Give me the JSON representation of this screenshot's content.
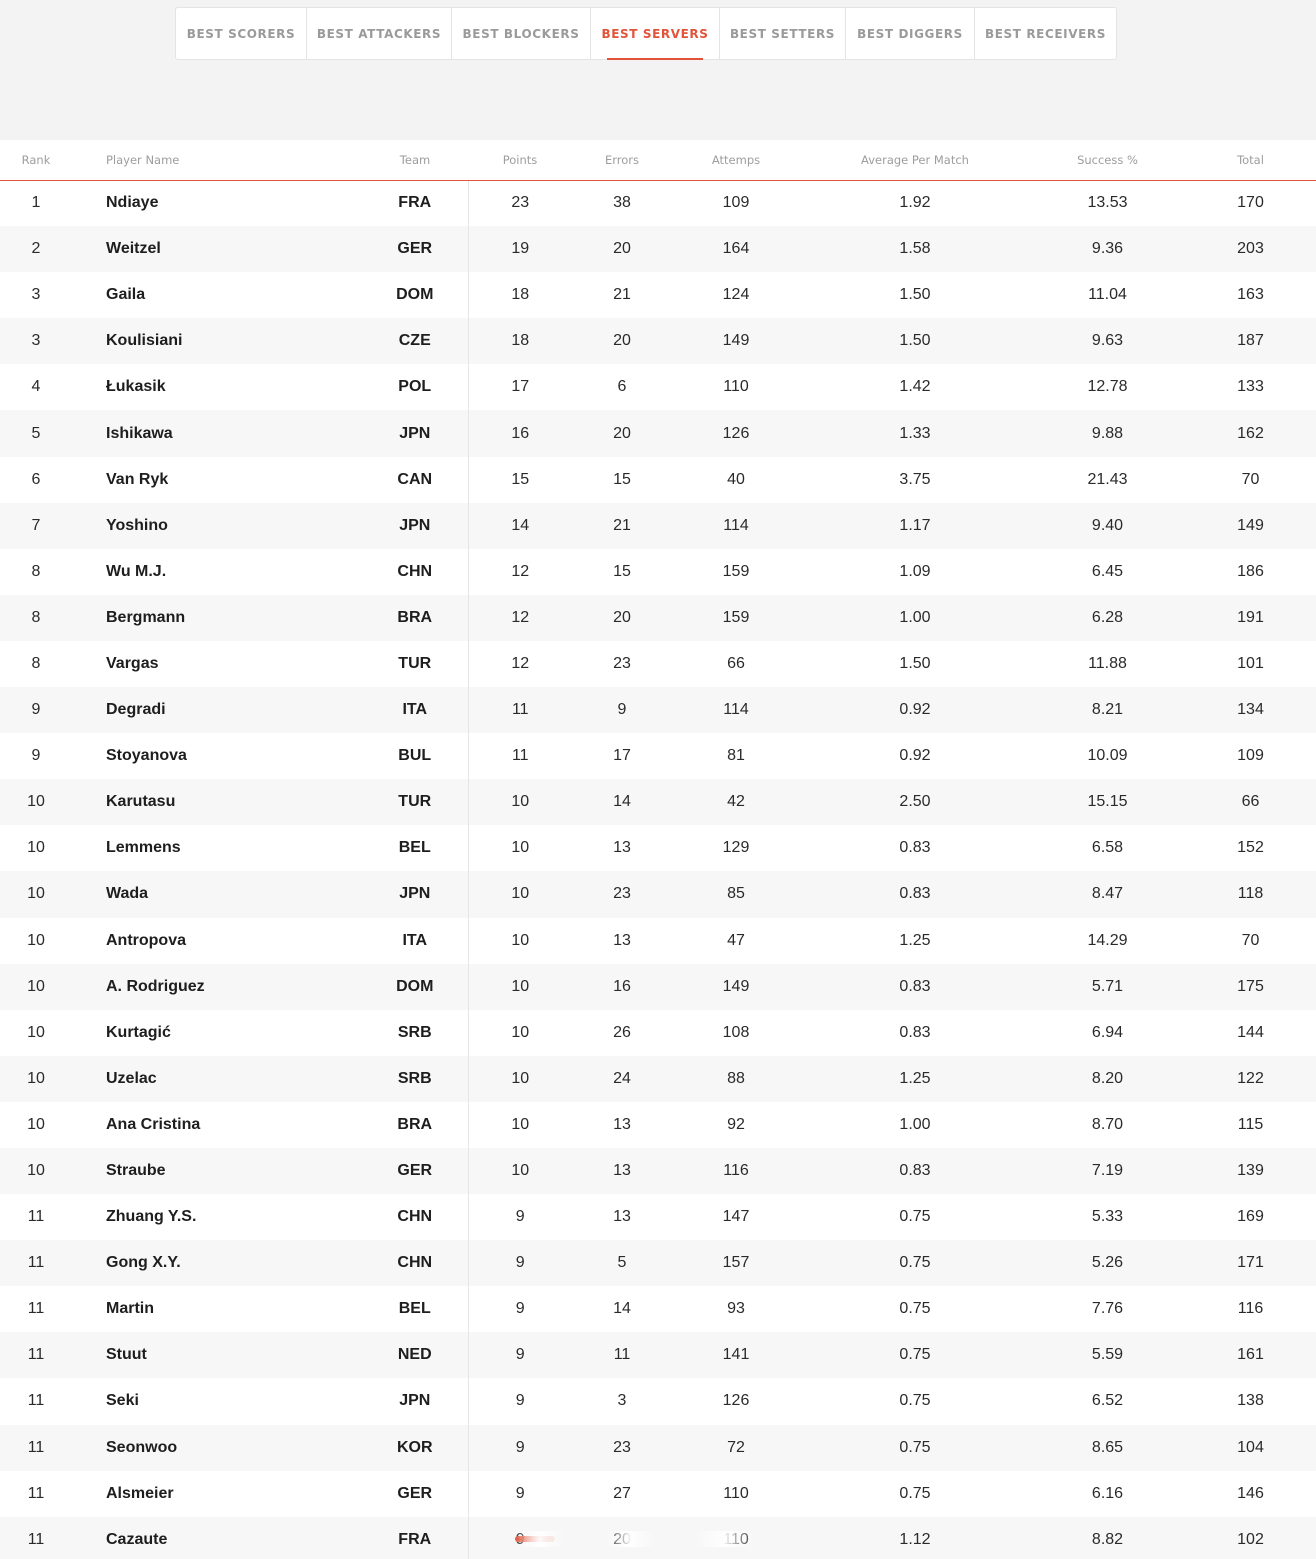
{
  "tabs": [
    {
      "label": "BEST SCORERS",
      "active": false
    },
    {
      "label": "BEST ATTACKERS",
      "active": false
    },
    {
      "label": "BEST BLOCKERS",
      "active": false
    },
    {
      "label": "BEST SERVERS",
      "active": true
    },
    {
      "label": "BEST SETTERS",
      "active": false
    },
    {
      "label": "BEST DIGGERS",
      "active": false
    },
    {
      "label": "BEST RECEIVERS",
      "active": false
    }
  ],
  "table": {
    "headers": {
      "rank": "Rank",
      "player": "Player Name",
      "team": "Team",
      "points": "Points",
      "errors": "Errors",
      "attempts": "Attemps",
      "avg": "Average Per Match",
      "success": "Success %",
      "total": "Total"
    },
    "rows": [
      {
        "rank": "1",
        "player": "Ndiaye",
        "team": "FRA",
        "points": "23",
        "errors": "38",
        "attempts": "109",
        "avg": "1.92",
        "success": "13.53",
        "total": "170"
      },
      {
        "rank": "2",
        "player": "Weitzel",
        "team": "GER",
        "points": "19",
        "errors": "20",
        "attempts": "164",
        "avg": "1.58",
        "success": "9.36",
        "total": "203"
      },
      {
        "rank": "3",
        "player": "Gaila",
        "team": "DOM",
        "points": "18",
        "errors": "21",
        "attempts": "124",
        "avg": "1.50",
        "success": "11.04",
        "total": "163"
      },
      {
        "rank": "3",
        "player": "Koulisiani",
        "team": "CZE",
        "points": "18",
        "errors": "20",
        "attempts": "149",
        "avg": "1.50",
        "success": "9.63",
        "total": "187"
      },
      {
        "rank": "4",
        "player": "Łukasik",
        "team": "POL",
        "points": "17",
        "errors": "6",
        "attempts": "110",
        "avg": "1.42",
        "success": "12.78",
        "total": "133"
      },
      {
        "rank": "5",
        "player": "Ishikawa",
        "team": "JPN",
        "points": "16",
        "errors": "20",
        "attempts": "126",
        "avg": "1.33",
        "success": "9.88",
        "total": "162"
      },
      {
        "rank": "6",
        "player": "Van Ryk",
        "team": "CAN",
        "points": "15",
        "errors": "15",
        "attempts": "40",
        "avg": "3.75",
        "success": "21.43",
        "total": "70"
      },
      {
        "rank": "7",
        "player": "Yoshino",
        "team": "JPN",
        "points": "14",
        "errors": "21",
        "attempts": "114",
        "avg": "1.17",
        "success": "9.40",
        "total": "149"
      },
      {
        "rank": "8",
        "player": "Wu M.J.",
        "team": "CHN",
        "points": "12",
        "errors": "15",
        "attempts": "159",
        "avg": "1.09",
        "success": "6.45",
        "total": "186"
      },
      {
        "rank": "8",
        "player": "Bergmann",
        "team": "BRA",
        "points": "12",
        "errors": "20",
        "attempts": "159",
        "avg": "1.00",
        "success": "6.28",
        "total": "191"
      },
      {
        "rank": "8",
        "player": "Vargas",
        "team": "TUR",
        "points": "12",
        "errors": "23",
        "attempts": "66",
        "avg": "1.50",
        "success": "11.88",
        "total": "101"
      },
      {
        "rank": "9",
        "player": "Degradi",
        "team": "ITA",
        "points": "11",
        "errors": "9",
        "attempts": "114",
        "avg": "0.92",
        "success": "8.21",
        "total": "134"
      },
      {
        "rank": "9",
        "player": "Stoyanova",
        "team": "BUL",
        "points": "11",
        "errors": "17",
        "attempts": "81",
        "avg": "0.92",
        "success": "10.09",
        "total": "109"
      },
      {
        "rank": "10",
        "player": "Karutasu",
        "team": "TUR",
        "points": "10",
        "errors": "14",
        "attempts": "42",
        "avg": "2.50",
        "success": "15.15",
        "total": "66"
      },
      {
        "rank": "10",
        "player": "Lemmens",
        "team": "BEL",
        "points": "10",
        "errors": "13",
        "attempts": "129",
        "avg": "0.83",
        "success": "6.58",
        "total": "152"
      },
      {
        "rank": "10",
        "player": "Wada",
        "team": "JPN",
        "points": "10",
        "errors": "23",
        "attempts": "85",
        "avg": "0.83",
        "success": "8.47",
        "total": "118"
      },
      {
        "rank": "10",
        "player": "Antropova",
        "team": "ITA",
        "points": "10",
        "errors": "13",
        "attempts": "47",
        "avg": "1.25",
        "success": "14.29",
        "total": "70"
      },
      {
        "rank": "10",
        "player": "A. Rodriguez",
        "team": "DOM",
        "points": "10",
        "errors": "16",
        "attempts": "149",
        "avg": "0.83",
        "success": "5.71",
        "total": "175"
      },
      {
        "rank": "10",
        "player": "Kurtagić",
        "team": "SRB",
        "points": "10",
        "errors": "26",
        "attempts": "108",
        "avg": "0.83",
        "success": "6.94",
        "total": "144"
      },
      {
        "rank": "10",
        "player": "Uzelac",
        "team": "SRB",
        "points": "10",
        "errors": "24",
        "attempts": "88",
        "avg": "1.25",
        "success": "8.20",
        "total": "122"
      },
      {
        "rank": "10",
        "player": "Ana Cristina",
        "team": "BRA",
        "points": "10",
        "errors": "13",
        "attempts": "92",
        "avg": "1.00",
        "success": "8.70",
        "total": "115"
      },
      {
        "rank": "10",
        "player": "Straube",
        "team": "GER",
        "points": "10",
        "errors": "13",
        "attempts": "116",
        "avg": "0.83",
        "success": "7.19",
        "total": "139"
      },
      {
        "rank": "11",
        "player": "Zhuang Y.S.",
        "team": "CHN",
        "points": "9",
        "errors": "13",
        "attempts": "147",
        "avg": "0.75",
        "success": "5.33",
        "total": "169"
      },
      {
        "rank": "11",
        "player": "Gong X.Y.",
        "team": "CHN",
        "points": "9",
        "errors": "5",
        "attempts": "157",
        "avg": "0.75",
        "success": "5.26",
        "total": "171"
      },
      {
        "rank": "11",
        "player": "Martin",
        "team": "BEL",
        "points": "9",
        "errors": "14",
        "attempts": "93",
        "avg": "0.75",
        "success": "7.76",
        "total": "116"
      },
      {
        "rank": "11",
        "player": "Stuut",
        "team": "NED",
        "points": "9",
        "errors": "11",
        "attempts": "141",
        "avg": "0.75",
        "success": "5.59",
        "total": "161"
      },
      {
        "rank": "11",
        "player": "Seki",
        "team": "JPN",
        "points": "9",
        "errors": "3",
        "attempts": "126",
        "avg": "0.75",
        "success": "6.52",
        "total": "138"
      },
      {
        "rank": "11",
        "player": "Seonwoo",
        "team": "KOR",
        "points": "9",
        "errors": "23",
        "attempts": "72",
        "avg": "0.75",
        "success": "8.65",
        "total": "104"
      },
      {
        "rank": "11",
        "player": "Alsmeier",
        "team": "GER",
        "points": "9",
        "errors": "27",
        "attempts": "110",
        "avg": "0.75",
        "success": "6.16",
        "total": "146"
      },
      {
        "rank": "11",
        "player": "Cazaute",
        "team": "FRA",
        "points": "9",
        "errors": "20",
        "attempts": "110",
        "avg": "1.12",
        "success": "8.82",
        "total": "102"
      }
    ]
  },
  "colors": {
    "accent": "#e2533a",
    "tab_text": "#9a9a9a",
    "header_text": "#9d9d9d",
    "body_text": "#2a2a2a",
    "page_background": "#f3f3f3",
    "row_stripe": "#f7f7f7"
  }
}
